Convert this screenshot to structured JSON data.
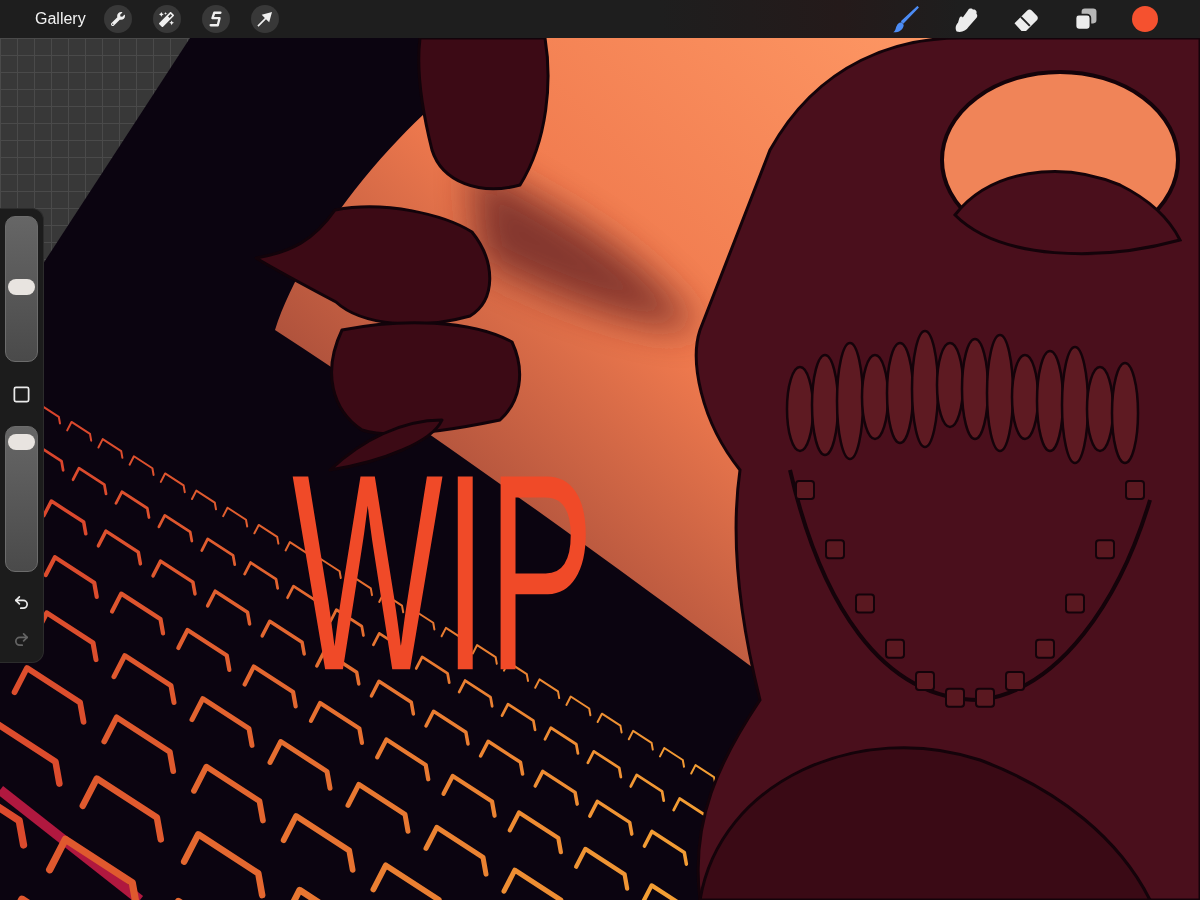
{
  "top_bar": {
    "gallery_label": "Gallery",
    "left_tools": [
      {
        "kind": "wrench"
      },
      {
        "kind": "wand"
      },
      {
        "kind": "selection"
      },
      {
        "kind": "arrow"
      }
    ],
    "right_tools": [
      {
        "kind": "brush",
        "selected": true
      },
      {
        "kind": "smudge",
        "selected": false
      },
      {
        "kind": "eraser",
        "selected": false
      },
      {
        "kind": "layers",
        "selected": false
      }
    ],
    "color_swatch": {
      "color": "#f5512f"
    }
  },
  "sidebar": {
    "brush_size": {
      "level": 0.52
    },
    "opacity": {
      "level": 0.96
    },
    "undo": {
      "disabled": false
    },
    "redo": {
      "disabled": true
    }
  },
  "canvas": {
    "lettering": "WIP"
  }
}
